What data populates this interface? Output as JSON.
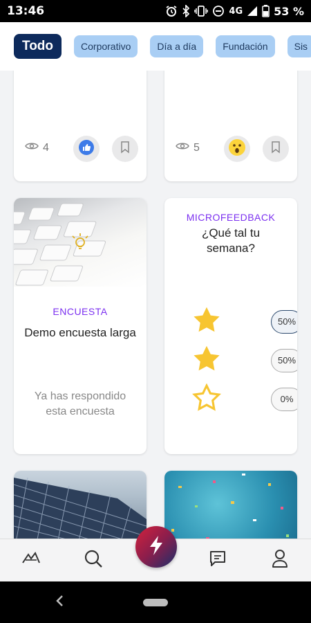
{
  "status_bar": {
    "time": "13:46",
    "network": "4G",
    "battery": "53 %",
    "icons": [
      "alarm-icon",
      "bluetooth-icon",
      "vibrate-icon",
      "do-not-disturb-icon",
      "signal-icon",
      "battery-icon"
    ]
  },
  "filters": [
    {
      "label": "Todo",
      "active": true
    },
    {
      "label": "Corporativo",
      "active": false
    },
    {
      "label": "Día a día",
      "active": false
    },
    {
      "label": "Fundación",
      "active": false
    },
    {
      "label": "Sis",
      "active": false
    }
  ],
  "cards": {
    "top_left": {
      "views": "4",
      "reaction_icon": "like-icon"
    },
    "top_right": {
      "views": "5",
      "reaction_icon": "surprised-emoji-icon"
    },
    "survey": {
      "tag": "ENCUESTA",
      "title": "Demo encuesta larga",
      "status": "Ya has respondido esta encuesta"
    },
    "microfeedback": {
      "tag": "MICROFEEDBACK",
      "question": "¿Qué tal tu semana?",
      "options": [
        {
          "stars": 3,
          "percent": "50%",
          "selected": true
        },
        {
          "stars": 2,
          "percent": "50%",
          "selected": false
        },
        {
          "stars": 1,
          "percent": "0%",
          "selected": false
        }
      ]
    }
  },
  "bottom_nav": {
    "items": [
      "home-logo-icon",
      "search-icon",
      "lightning-icon",
      "chat-icon",
      "profile-icon"
    ]
  },
  "colors": {
    "chip_active": "#0d2a5c",
    "chip": "#a9cef4",
    "tag": "#7b2ff0",
    "star": "#f7c531"
  }
}
